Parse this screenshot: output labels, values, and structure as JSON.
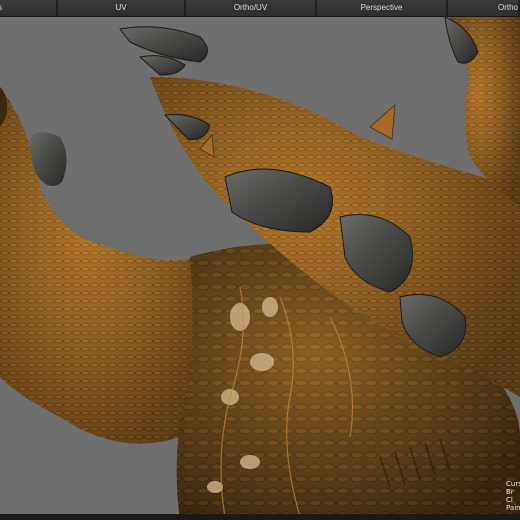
{
  "tabs": [
    {
      "label": "s"
    },
    {
      "label": "UV"
    },
    {
      "label": "Ortho/UV"
    },
    {
      "label": "Perspective"
    },
    {
      "label": "Ortho"
    }
  ],
  "viewport": {
    "hud_lines": [
      "Curs",
      "Br",
      "Cl",
      "Paint B"
    ]
  },
  "colors": {
    "background": "#6e6e6e",
    "skin_dark": "#3b2a14",
    "skin_mid": "#8a5a22",
    "skin_light": "#c98a3a",
    "claw": "#4a4a48"
  }
}
